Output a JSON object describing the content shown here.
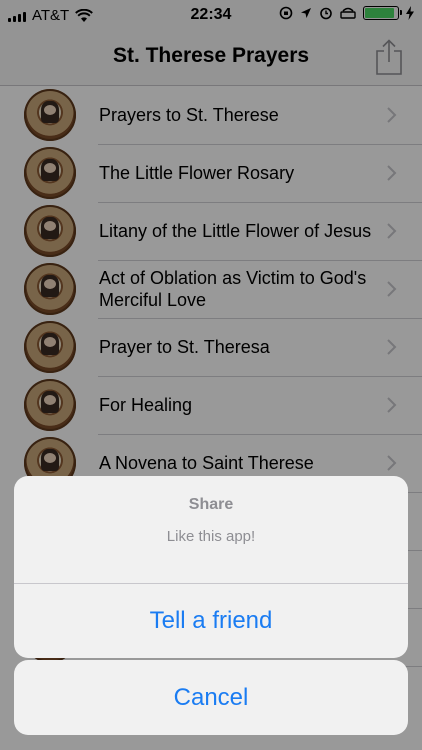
{
  "status_bar": {
    "carrier": "AT&T",
    "time": "22:34"
  },
  "nav": {
    "title": "St. Therese Prayers",
    "share_icon": "share-icon"
  },
  "list": {
    "items": [
      {
        "label": "Prayers to St. Therese"
      },
      {
        "label": "The Little Flower Rosary"
      },
      {
        "label": "Litany of the Little Flower of Jesus"
      },
      {
        "label": "Act of Oblation as Victim to God's Merciful Love"
      },
      {
        "label": "Prayer to St. Theresa"
      },
      {
        "label": "For Healing"
      },
      {
        "label": "A Novena to Saint Therese"
      }
    ]
  },
  "action_sheet": {
    "title": "Share",
    "message": "Like this app!",
    "action_label": "Tell a friend",
    "cancel_label": "Cancel"
  },
  "colors": {
    "accent": "#1a7cf2",
    "battery": "#4cd964"
  }
}
